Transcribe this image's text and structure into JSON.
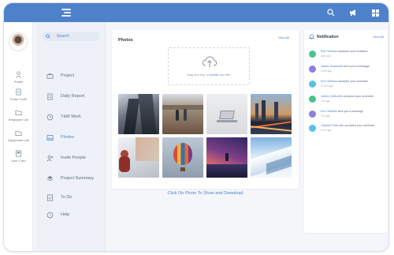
{
  "search": {
    "label": "Search"
  },
  "rail": [
    {
      "label": "Profile"
    },
    {
      "label": "Photo Code"
    },
    {
      "label": "Employee List"
    },
    {
      "label": "Equipment List"
    },
    {
      "label": "User Card"
    }
  ],
  "menu": [
    {
      "label": "Project"
    },
    {
      "label": "Daily Report"
    },
    {
      "label": "T&M Work"
    },
    {
      "label": "Photos"
    },
    {
      "label": "Invite People"
    },
    {
      "label": "Project Summary"
    },
    {
      "label": "To Do"
    },
    {
      "label": "Help"
    }
  ],
  "photos": {
    "title": "Photos",
    "view_all": "View All",
    "drop_prefix": "Drag and drop, or",
    "drop_link": "browse",
    "drop_suffix": "your files",
    "caption": "Click On Photo To Show and Download"
  },
  "notifications": {
    "title": "Notification",
    "view_all": "View All",
    "items": [
      {
        "who": "Eric Hoffman",
        "text": " accepted your invitation",
        "time": "Just now",
        "color": "#4cc38a"
      },
      {
        "who": "James Goldsmith",
        "text": " send you a message",
        "time": "2 min ago",
        "color": "#8b7fe0"
      },
      {
        "who": "Eric Hoffman",
        "text": " accepted your schedule",
        "time": "12 min ago",
        "color": "#56c2e6"
      },
      {
        "who": "James Goldsmith",
        "text": " accepted your schedule",
        "time": "1 hr ago",
        "color": "#4cc38a"
      },
      {
        "who": "Eric Hoffman",
        "text": " sent you a message",
        "time": "2 hr ago",
        "color": "#8b7fe0"
      },
      {
        "who": "Claudia Pettit",
        "text": " user accepted your schedule",
        "time": "10 hr ago",
        "color": "#56c2e6"
      }
    ]
  },
  "colors": {
    "primary": "#4d82cb",
    "rail_bg": "#ffffff",
    "menu_bg": "#eef2f8",
    "page_bg": "#f4f6fa"
  }
}
